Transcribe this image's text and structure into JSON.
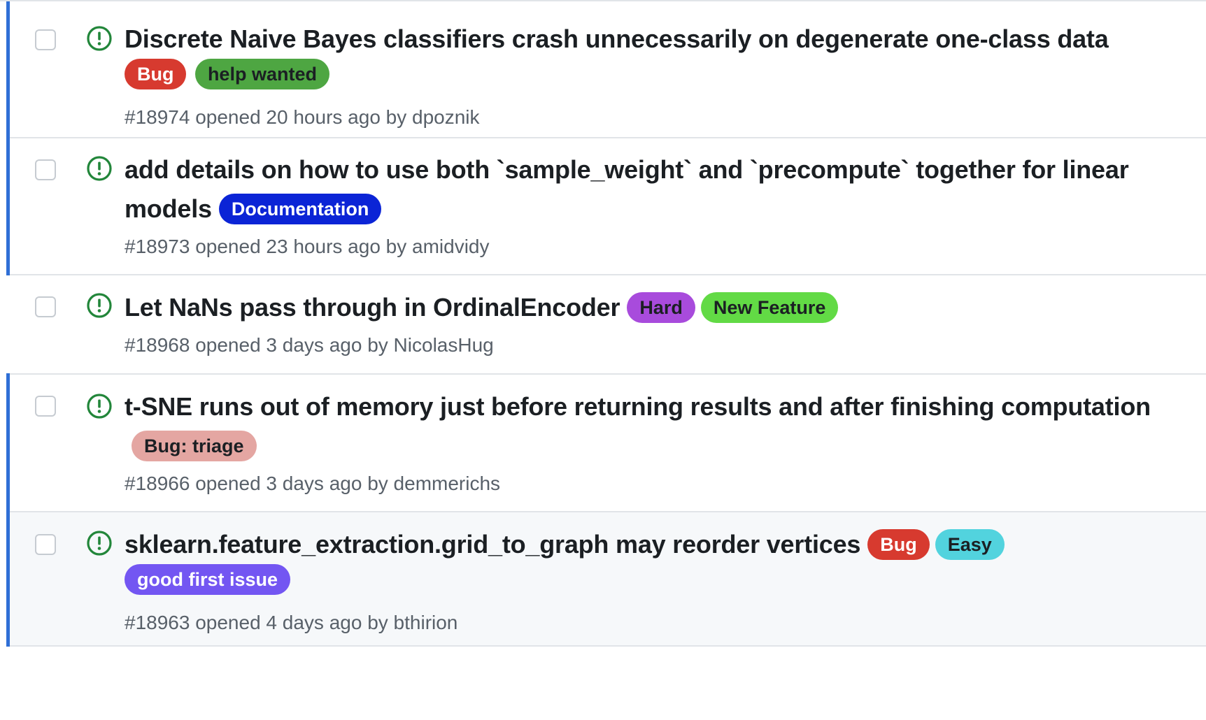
{
  "issues": [
    {
      "title": "Discrete Naive Bayes classifiers crash unnecessarily on degenerate one-class data",
      "labels": [
        {
          "text": "Bug",
          "bg": "#d73a2f",
          "fg": "#ffffff"
        },
        {
          "text": "help wanted",
          "bg": "#4ea642",
          "fg": "#1b1f23"
        }
      ],
      "meta": "#18974 opened 20 hours ago by dpoznik"
    },
    {
      "title": "add details on how to use both `sample_weight` and `precompute` together for linear models",
      "labels": [
        {
          "text": "Documentation",
          "bg": "#0b24d6",
          "fg": "#ffffff"
        }
      ],
      "meta": "#18973 opened 23 hours ago by amidvidy"
    },
    {
      "title": "Let NaNs pass through in OrdinalEncoder",
      "labels": [
        {
          "text": "Hard",
          "bg": "#a84bdc",
          "fg": "#1b1f23"
        },
        {
          "text": "New Feature",
          "bg": "#62da45",
          "fg": "#1b1f23"
        }
      ],
      "meta": "#18968 opened 3 days ago by NicolasHug"
    },
    {
      "title": "t-SNE runs out of memory just before returning results and after finishing computation",
      "labels": [
        {
          "text": "Bug: triage",
          "bg": "#e4a6a2",
          "fg": "#1b1f23"
        }
      ],
      "meta": "#18966 opened 3 days ago by demmerichs"
    },
    {
      "title": "sklearn.feature_extraction.grid_to_graph may reorder vertices",
      "labels": [
        {
          "text": "Bug",
          "bg": "#d73a2f",
          "fg": "#ffffff"
        },
        {
          "text": "Easy",
          "bg": "#52d3de",
          "fg": "#1b1f23"
        },
        {
          "text": "good first issue",
          "bg": "#7356f2",
          "fg": "#ffffff"
        }
      ],
      "meta": "#18963 opened 4 days ago by bthirion"
    }
  ],
  "colors": {
    "open_icon": "#22863a",
    "unread_marker": "#2f6fd6"
  }
}
